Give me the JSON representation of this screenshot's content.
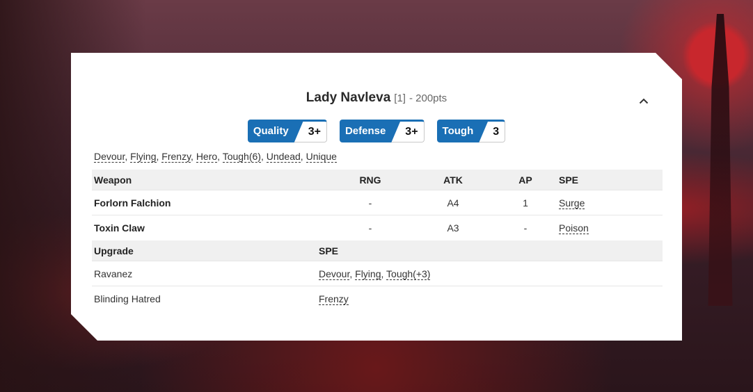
{
  "unit": {
    "name": "Lady Navleva",
    "size": "[1]",
    "cost": "- 200pts"
  },
  "stats": [
    {
      "label": "Quality",
      "value": "3+"
    },
    {
      "label": "Defense",
      "value": "3+"
    },
    {
      "label": "Tough",
      "value": "3"
    }
  ],
  "rules": [
    "Devour",
    "Flying",
    "Frenzy",
    "Hero",
    "Tough(6)",
    "Undead",
    "Unique"
  ],
  "weapons": {
    "headers": {
      "weapon": "Weapon",
      "rng": "RNG",
      "atk": "ATK",
      "ap": "AP",
      "spe": "SPE"
    },
    "rows": [
      {
        "name": "Forlorn Falchion",
        "rng": "-",
        "atk": "A4",
        "ap": "1",
        "spe": "Surge"
      },
      {
        "name": "Toxin Claw",
        "rng": "-",
        "atk": "A3",
        "ap": "-",
        "spe": "Poison"
      }
    ]
  },
  "upgrades": {
    "headers": {
      "upgrade": "Upgrade",
      "spe": "SPE"
    },
    "rows": [
      {
        "name": "Ravanez",
        "spe": [
          "Devour",
          "Flying",
          "Tough(+3)"
        ]
      },
      {
        "name": "Blinding Hatred",
        "spe": [
          "Frenzy"
        ]
      }
    ]
  },
  "colors": {
    "accent": "#1a6fb5"
  },
  "icons": {
    "collapse": "chevron-up-icon"
  }
}
